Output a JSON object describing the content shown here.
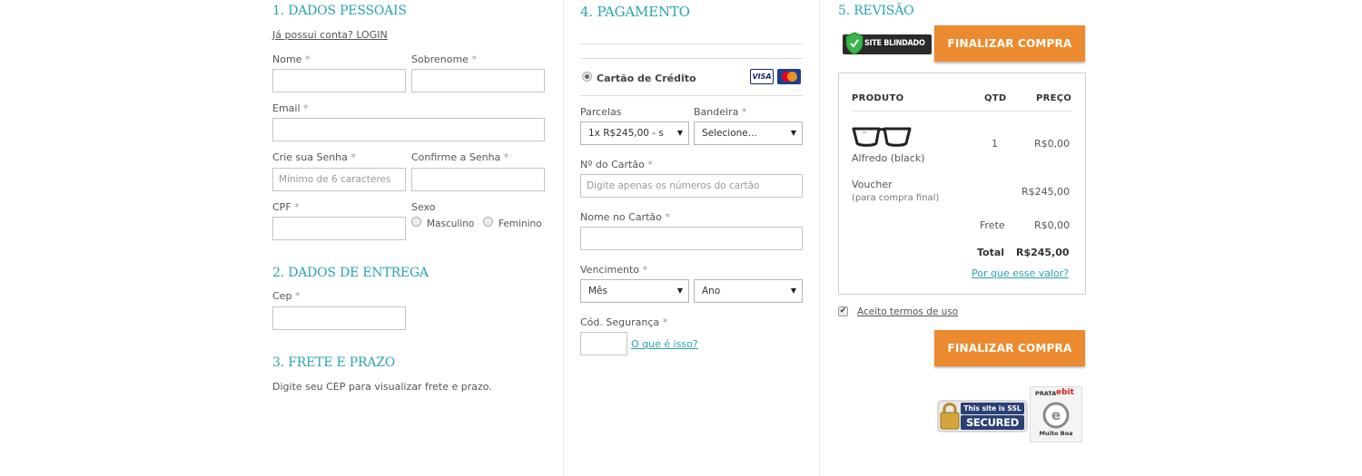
{
  "colors": {
    "accent": "#2aa3b0",
    "button": "#ec8a2f"
  },
  "personal": {
    "title": "1. DADOS PESSOAIS",
    "login_link": "Já possui conta? LOGIN",
    "nome_label": "Nome",
    "sobrenome_label": "Sobrenome",
    "email_label": "Email",
    "senha_label": "Crie sua Senha",
    "senha_placeholder": "Mínimo de 6 caracteres",
    "confirme_label": "Confirme a Senha",
    "cpf_label": "CPF",
    "sexo_label": "Sexo",
    "masculino": "Masculino",
    "feminino": "Feminino",
    "required_mark": "*"
  },
  "delivery": {
    "title": "2. DADOS DE ENTREGA",
    "cep_label": "Cep"
  },
  "shipping": {
    "title": "3. FRETE E PRAZO",
    "hint": "Digite seu CEP para visualizar frete e prazo."
  },
  "payment": {
    "title": "4. PAGAMENTO",
    "method": "Cartão de Crédito",
    "visa_icon": "visa-icon",
    "mastercard_icon": "mastercard-icon",
    "visa_text": "VISA",
    "parcelas_label": "Parcelas",
    "parcelas_value": "1x R$245,00 - s",
    "bandeira_label": "Bandeira",
    "bandeira_value": "Selecione...",
    "card_number_label": "Nº do Cartão",
    "card_number_placeholder": "Digite apenas os números do cartão",
    "card_name_label": "Nome no Cartão",
    "vencimento_label": "Vencimento",
    "mes_value": "Mês",
    "ano_value": "Ano",
    "cod_label": "Cód. Segurança",
    "cod_link": "O que é isso?"
  },
  "review": {
    "title": "5. REVISÃO",
    "site_blindado": "SITE BLINDADO",
    "finalize_label": "FINALIZAR COMPRA",
    "col_produto": "PRODUTO",
    "col_qtd": "QTD",
    "col_preco": "PREÇO",
    "item_name": "Alfredo",
    "item_variant": "(black)",
    "item_qty": "1",
    "item_price": "R$0,00",
    "voucher_label": "Voucher",
    "voucher_sub": "(para compra final)",
    "voucher_price": "R$245,00",
    "frete_label": "Frete",
    "frete_price": "R$0,00",
    "total_label": "Total",
    "total_price": "R$245,00",
    "why_link": "Por que esse valor?",
    "terms": "Aceito termos de uso",
    "ssl_line1": "This site is SSL",
    "ssl_line2": "SECURED",
    "ebit_top": "PRATA",
    "ebit_brand": "ebit",
    "ebit_bottom": "Muito Boa"
  }
}
